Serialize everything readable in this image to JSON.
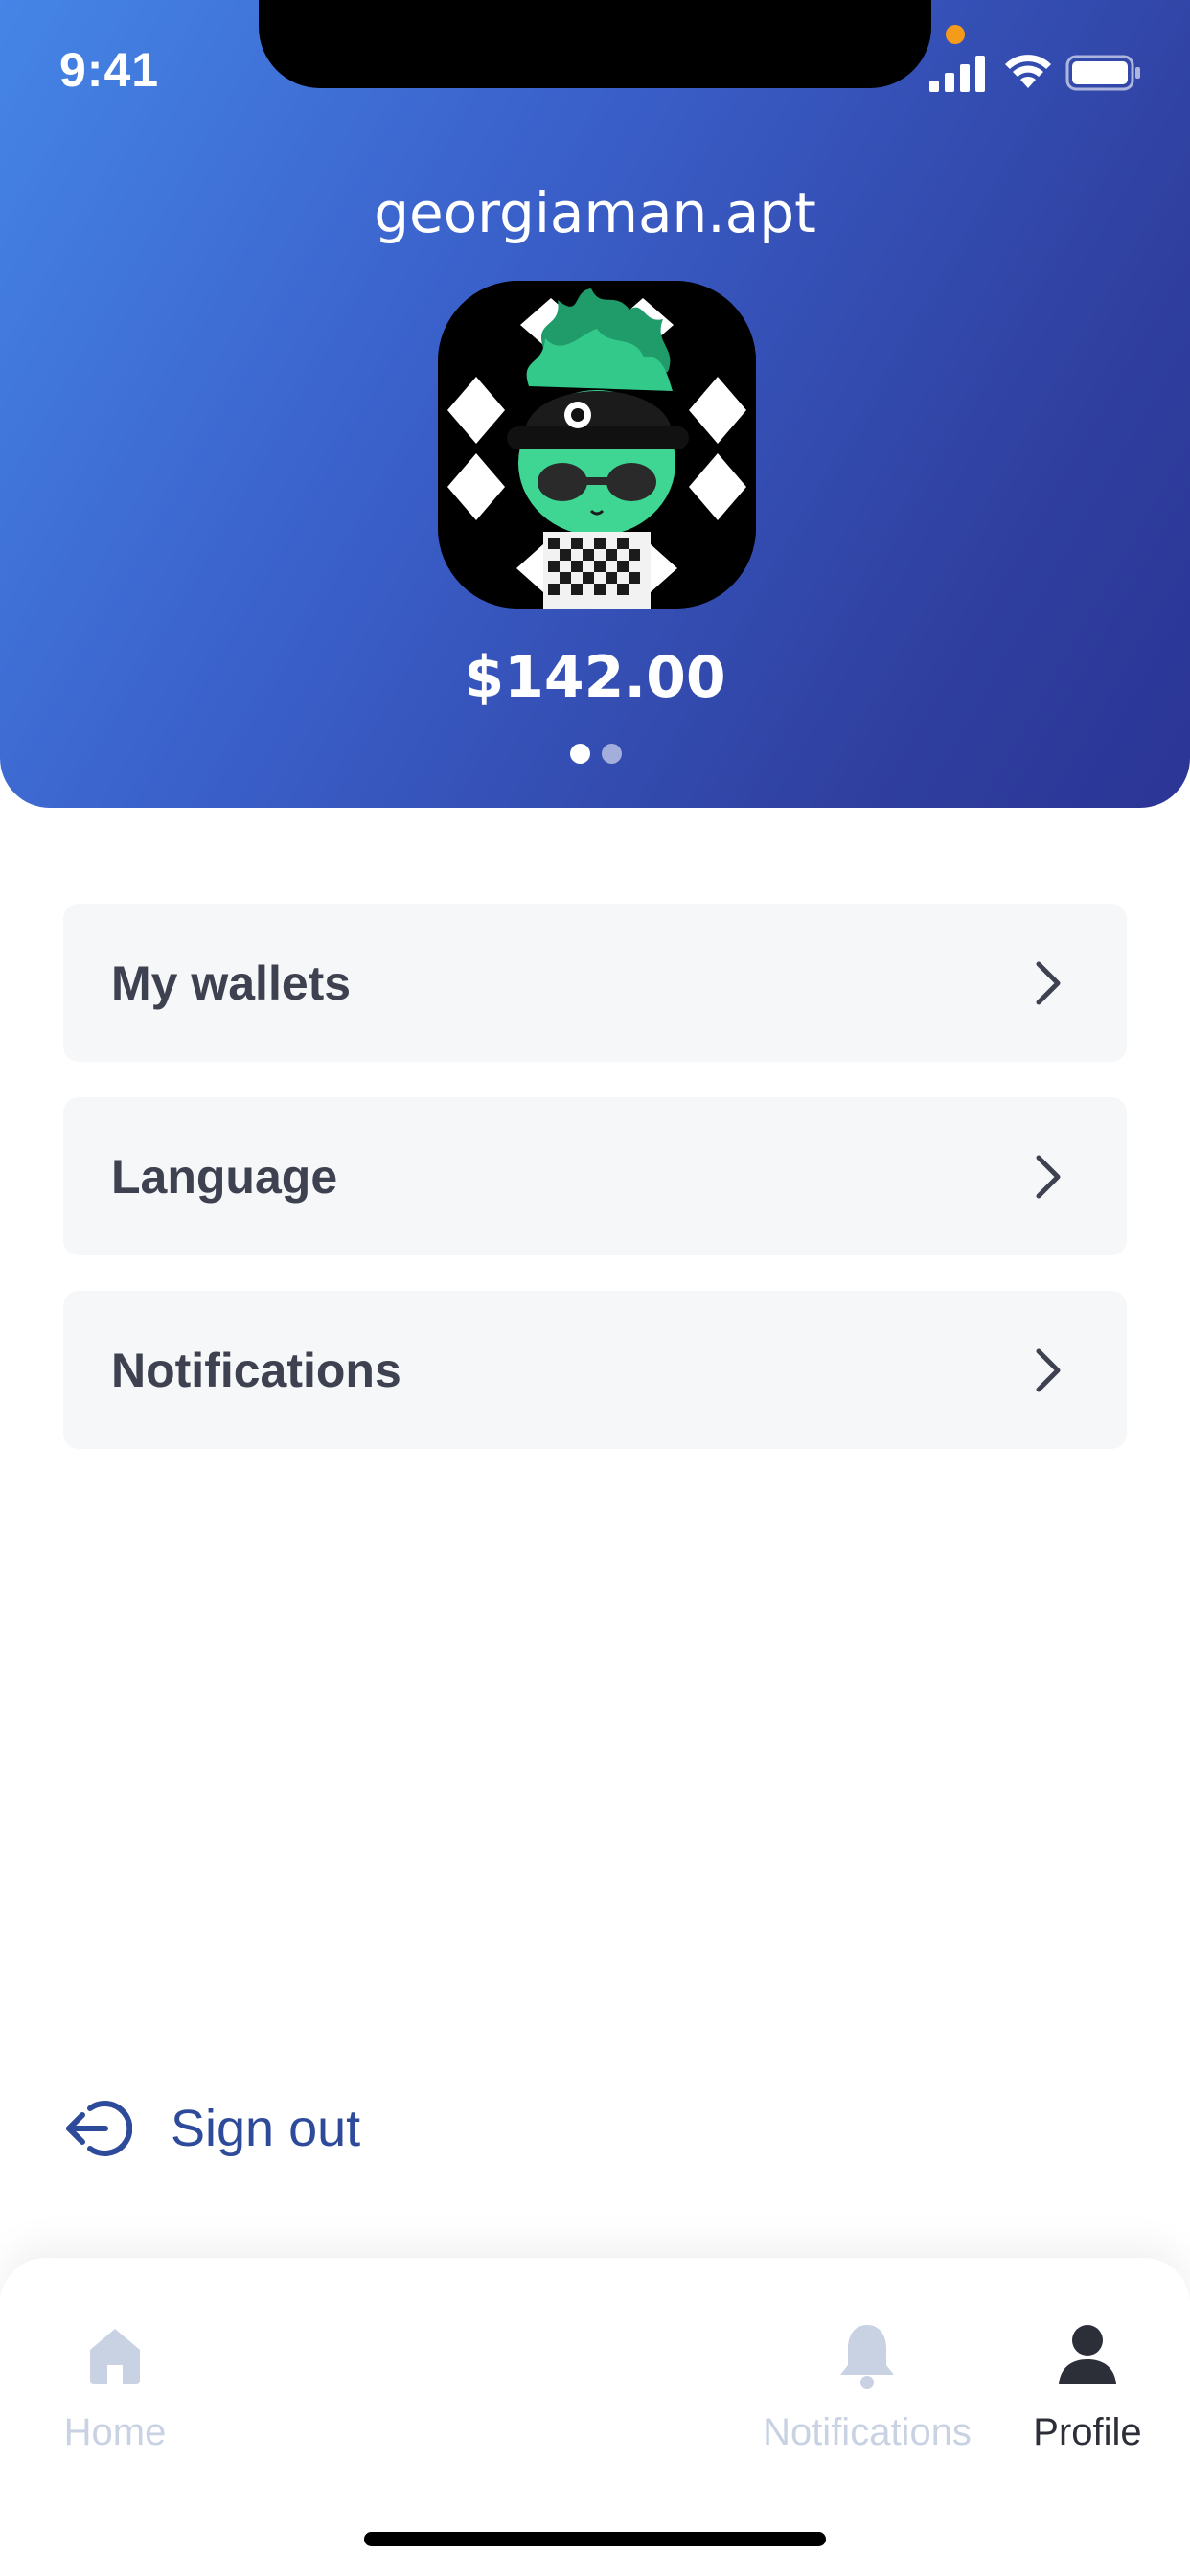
{
  "status_bar": {
    "time": "9:41"
  },
  "profile": {
    "username": "georgiaman.apt",
    "balance": "$142.00",
    "avatar_icon": "nft-alien-avatar-icon"
  },
  "carousel": {
    "pages": 2,
    "active": 1
  },
  "menu": {
    "items": [
      {
        "label": "My wallets"
      },
      {
        "label": "Language"
      },
      {
        "label": "Notifications"
      }
    ]
  },
  "sign_out": {
    "label": "Sign out"
  },
  "tabbar": {
    "tabs": [
      {
        "label": "Home",
        "icon": "home-icon",
        "active": false
      },
      {
        "label": "Notifications",
        "icon": "bell-icon",
        "active": false
      },
      {
        "label": "Profile",
        "icon": "person-icon",
        "active": true
      }
    ]
  },
  "colors": {
    "header_gradient_start": "#4585e6",
    "header_gradient_end": "#2b3596",
    "menu_bg": "#f6f7f9",
    "sign_out": "#2e4a9a",
    "tab_inactive": "#c9d2e3",
    "tab_active": "#2d2f38"
  }
}
